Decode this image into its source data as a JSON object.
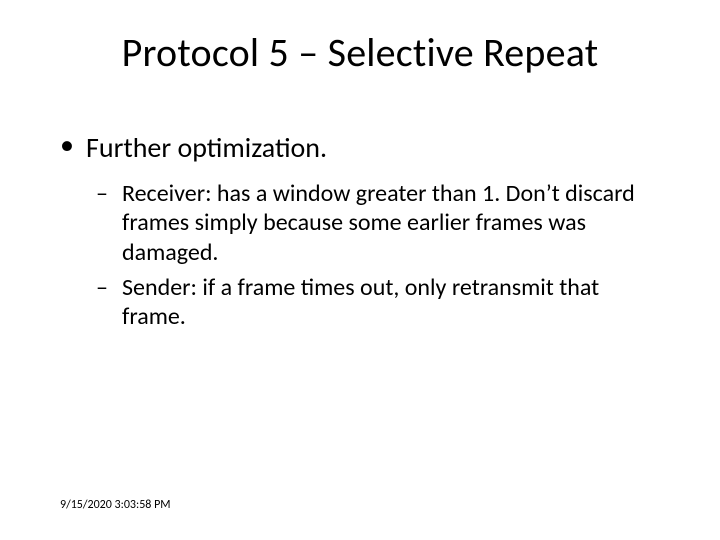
{
  "title": "Protocol 5 – Selective Repeat",
  "bullets": {
    "lvl1": {
      "marker": "•",
      "text": "Further optimization."
    },
    "lvl2": [
      {
        "marker": "–",
        "text": "Receiver: has a window greater than 1. Don’t discard frames simply because some earlier frames was damaged."
      },
      {
        "marker": "–",
        "text": "Sender: if a frame times out, only retransmit that frame."
      }
    ]
  },
  "footer": "9/15/2020 3:03:58 PM"
}
